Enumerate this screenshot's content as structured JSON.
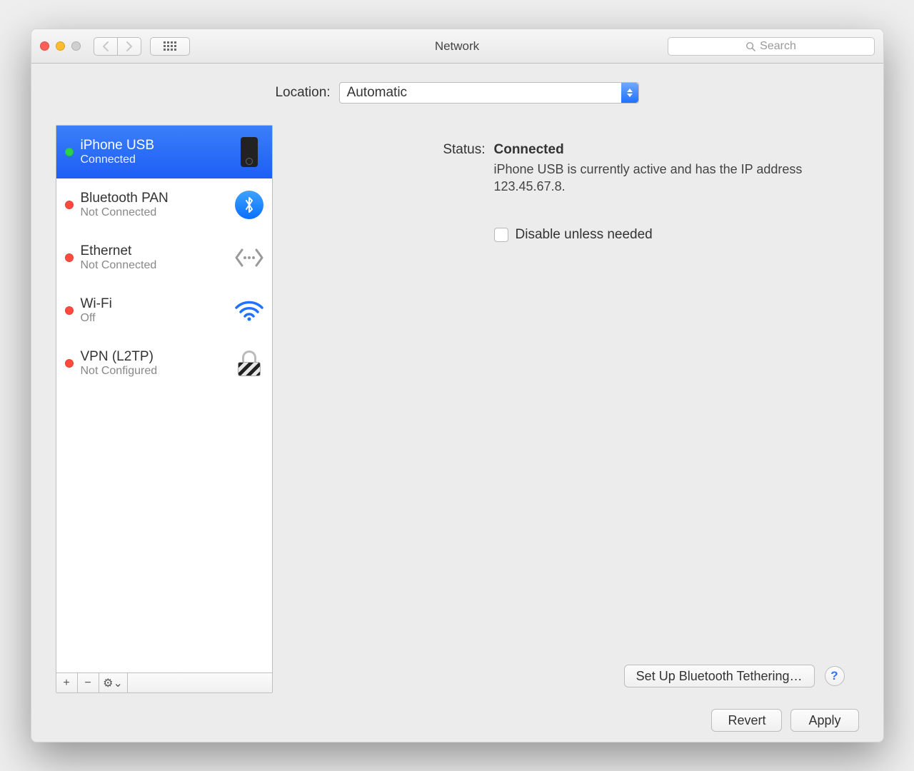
{
  "title": "Network",
  "search_placeholder": "Search",
  "location": {
    "label": "Location:",
    "value": "Automatic"
  },
  "services": [
    {
      "name": "iPhone USB",
      "status": "Connected",
      "dot": "green",
      "icon": "iphone",
      "selected": true
    },
    {
      "name": "Bluetooth PAN",
      "status": "Not Connected",
      "dot": "red",
      "icon": "bluetooth",
      "selected": false
    },
    {
      "name": "Ethernet",
      "status": "Not Connected",
      "dot": "red",
      "icon": "ethernet",
      "selected": false
    },
    {
      "name": "Wi-Fi",
      "status": "Off",
      "dot": "red",
      "icon": "wifi",
      "selected": false
    },
    {
      "name": "VPN (L2TP)",
      "status": "Not Configured",
      "dot": "red",
      "icon": "vpn",
      "selected": false
    }
  ],
  "detail": {
    "status_label": "Status:",
    "status_value": "Connected",
    "description": "iPhone USB is currently active and has the IP address 123.45.67.8.",
    "disable_checkbox_label": "Disable unless needed",
    "advanced_button": "Set Up Bluetooth Tethering…",
    "help_glyph": "?"
  },
  "buttons": {
    "revert": "Revert",
    "apply": "Apply"
  },
  "toolbar_icons": {
    "add": "+",
    "remove": "−",
    "gear": "⚙︎⌄"
  }
}
